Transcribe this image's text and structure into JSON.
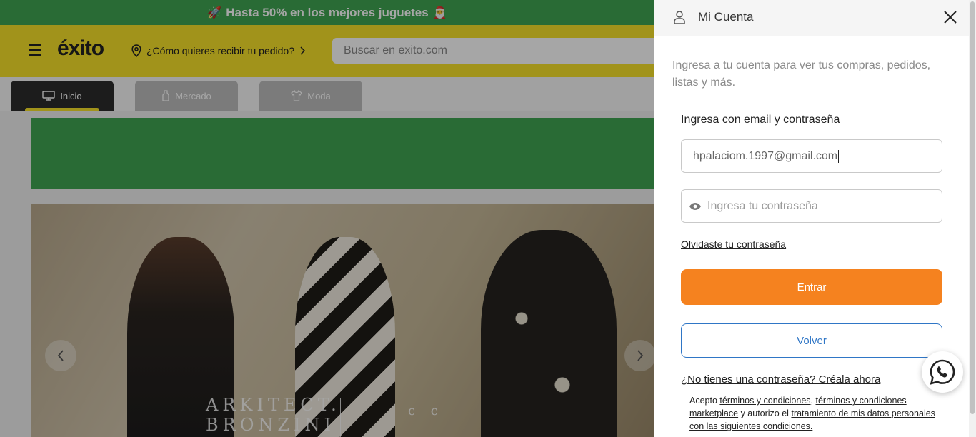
{
  "promo": {
    "text": "Hasta 50% en los mejores juguetes",
    "left_emoji": "🚀",
    "right_emoji": "🎅"
  },
  "header": {
    "logo_text": "éxito",
    "delivery_label": "¿Cómo quieres recibir tu pedido?",
    "search_placeholder": "Buscar en exito.com"
  },
  "tabs": [
    {
      "label": "Inicio",
      "icon": "monitor-icon",
      "active": true
    },
    {
      "label": "Mercado",
      "icon": "bottle-icon",
      "active": false
    },
    {
      "label": "Moda",
      "icon": "shirt-icon",
      "active": false
    }
  ],
  "hero": {
    "brand_line1": "ARKITECT.",
    "brand_line2": "BRONZINI",
    "brand_secondary": "c  c"
  },
  "panel": {
    "title": "Mi Cuenta",
    "intro": "Ingresa a tu cuenta para ver tus compras, pedidos, listas y más.",
    "section_title": "Ingresa con email y contraseña",
    "email_value": "hpalaciom.1997@gmail.com",
    "password_placeholder": "Ingresa tu contraseña",
    "forgot_link": "Olvidaste tu contraseña",
    "submit_label": "Entrar",
    "back_label": "Volver",
    "register_link": "¿No tienes una contraseña? Créala ahora",
    "terms_prefix": "Acepto ",
    "terms_link1": "términos y condiciones",
    "terms_comma": ", ",
    "terms_link2": "términos y condiciones marketplace",
    "terms_middle": " y autorizo el ",
    "terms_link3": "tratamiento de mis datos personales con las siguientes condiciones."
  },
  "colors": {
    "brand_yellow": "#f7e22a",
    "promo_green": "#3fa552",
    "primary_orange": "#f5821f",
    "link_blue": "#2f76c6"
  }
}
